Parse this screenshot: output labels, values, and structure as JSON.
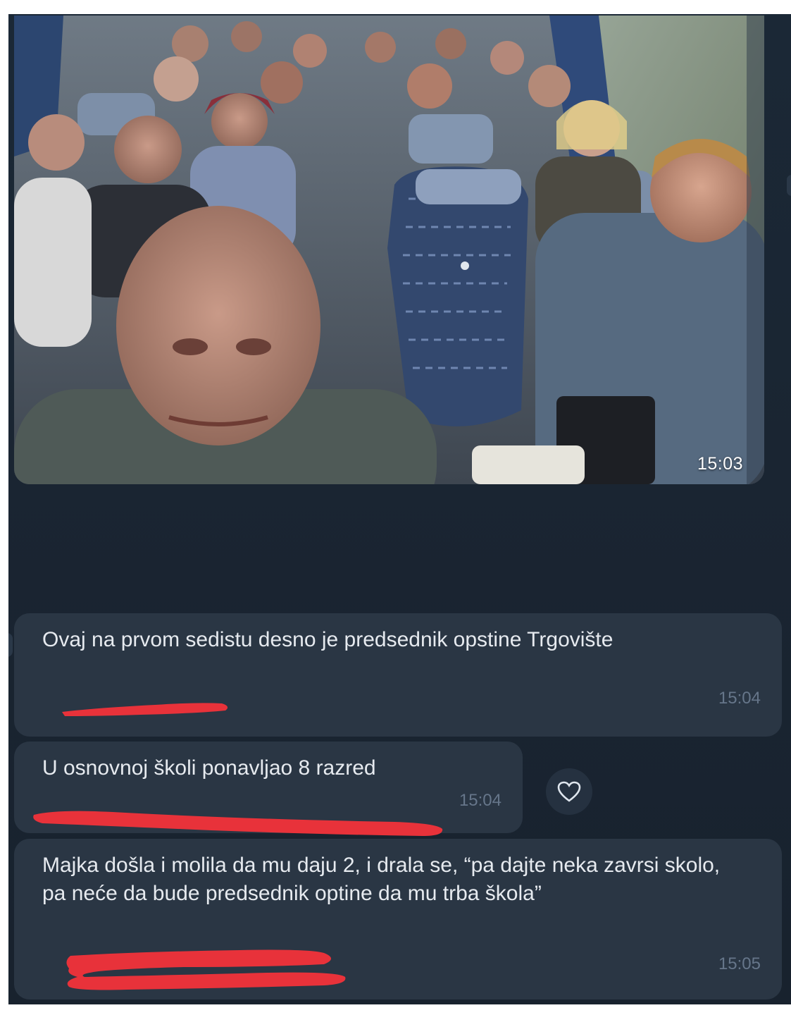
{
  "photo_message": {
    "time": "15:03"
  },
  "messages": [
    {
      "text": "Ovaj na prvom sedistu desno je predsednik opstine Trgovište",
      "time": "15:04"
    },
    {
      "text": "U osnovnoj školi ponavljao 8 razred",
      "time": "15:04"
    },
    {
      "text": "Majka došla i molila da mu daju 2, i drala se, “pa dajte neka zavrsi skolo, pa neće da bude predsednik optine da mu trba škola”",
      "time": "15:05"
    }
  ],
  "reaction": {
    "icon": "heart-icon"
  },
  "colors": {
    "chat_background": "#1b2836",
    "bubble": "#2a3644",
    "bubble_text": "#e6eaef",
    "timestamp": "#66768a",
    "underline_marker": "#e8323a"
  }
}
